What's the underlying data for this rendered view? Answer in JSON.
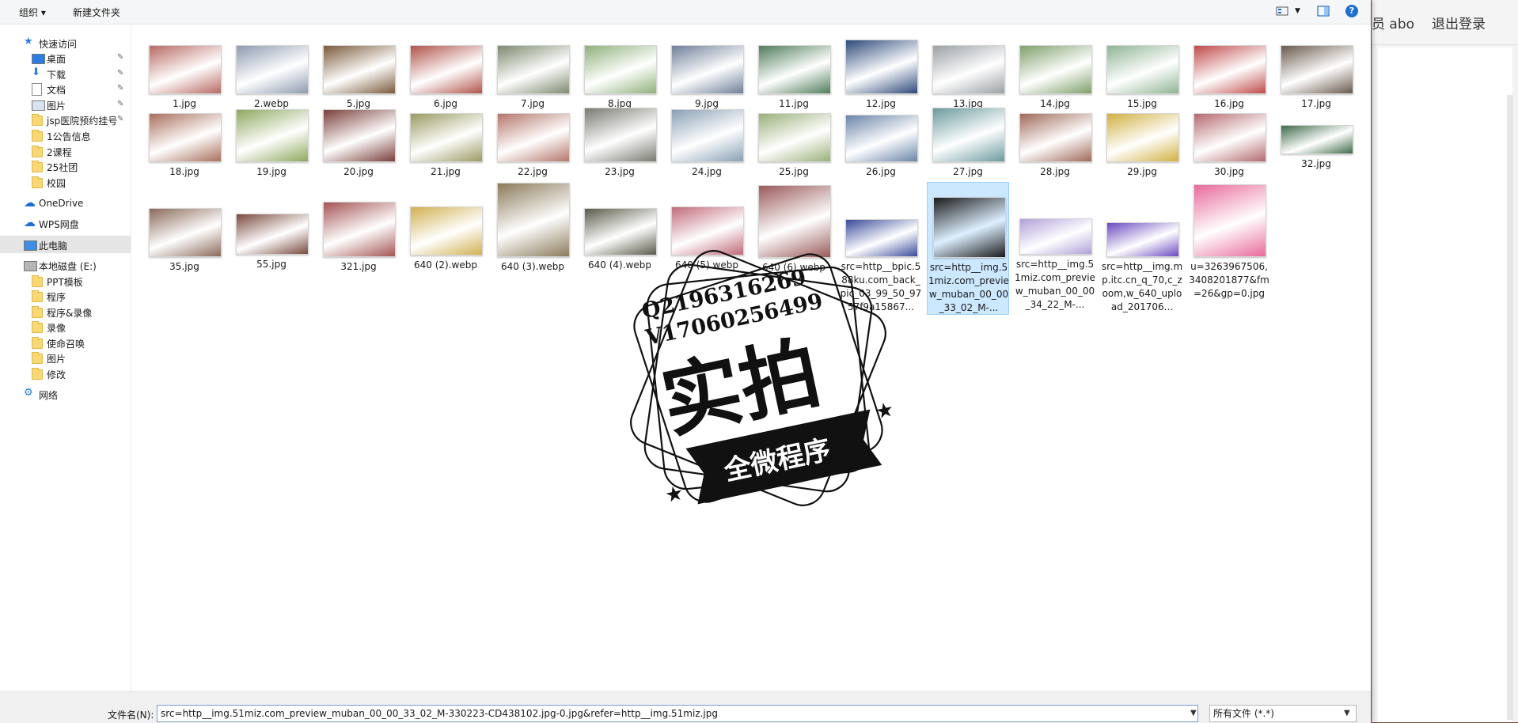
{
  "background_page": {
    "user_text": "员 abo",
    "logout_label": "退出登录"
  },
  "toolbar": {
    "organize_label": "组织 ▾",
    "new_folder_label": "新建文件夹",
    "help_label": "?"
  },
  "nav": {
    "items": [
      {
        "label": "快速访问",
        "icon": "star-icon"
      },
      {
        "label": "桌面",
        "icon": "desktop-icon",
        "pinned": true
      },
      {
        "label": "下载",
        "icon": "download-icon",
        "pinned": true
      },
      {
        "label": "文档",
        "icon": "document-icon",
        "pinned": true
      },
      {
        "label": "图片",
        "icon": "pictures-icon",
        "pinned": true
      },
      {
        "label": "jsp医院预约挂号",
        "icon": "folder-icon",
        "pinned": true
      },
      {
        "label": "1公告信息",
        "icon": "folder-icon"
      },
      {
        "label": "2课程",
        "icon": "folder-icon"
      },
      {
        "label": "25社团",
        "icon": "folder-icon"
      },
      {
        "label": "校园",
        "icon": "folder-icon"
      },
      {
        "label": "OneDrive",
        "icon": "cloud-icon"
      },
      {
        "label": "WPS网盘",
        "icon": "cloud-icon"
      },
      {
        "label": "此电脑",
        "icon": "computer-icon"
      },
      {
        "label": "本地磁盘 (E:)",
        "icon": "drive-icon"
      },
      {
        "label": "PPT模板",
        "icon": "folder-icon"
      },
      {
        "label": "程序",
        "icon": "folder-icon"
      },
      {
        "label": "程序&录像",
        "icon": "folder-icon"
      },
      {
        "label": "录像",
        "icon": "folder-icon"
      },
      {
        "label": "使命召唤",
        "icon": "folder-icon"
      },
      {
        "label": "图片",
        "icon": "folder-icon"
      },
      {
        "label": "修改",
        "icon": "folder-icon"
      },
      {
        "label": "网络",
        "icon": "network-icon"
      }
    ]
  },
  "files": [
    {
      "name": "1.jpg",
      "color": "#b86a63"
    },
    {
      "name": "2.webp",
      "color": "#8e9bb0"
    },
    {
      "name": "5.jpg",
      "color": "#7a5a3a"
    },
    {
      "name": "6.jpg",
      "color": "#b0534a"
    },
    {
      "name": "7.jpg",
      "color": "#7d8a6e"
    },
    {
      "name": "8.jpg",
      "color": "#8fb07a"
    },
    {
      "name": "9.jpg",
      "color": "#6f8099"
    },
    {
      "name": "11.jpg",
      "color": "#4f7d5a"
    },
    {
      "name": "12.jpg",
      "color": "#2e4a7a"
    },
    {
      "name": "13.jpg",
      "color": "#9aa0a4"
    },
    {
      "name": "14.jpg",
      "color": "#7fa06a"
    },
    {
      "name": "15.jpg",
      "color": "#8fb494"
    },
    {
      "name": "16.jpg",
      "color": "#c04a4a"
    },
    {
      "name": "17.jpg",
      "color": "#6a5a4e"
    },
    {
      "name": "18.jpg",
      "color": "#a8705c"
    },
    {
      "name": "19.jpg",
      "color": "#8ea85e"
    },
    {
      "name": "20.jpg",
      "color": "#7a3e3a"
    },
    {
      "name": "21.jpg",
      "color": "#9a9a62"
    },
    {
      "name": "22.jpg",
      "color": "#b4766a"
    },
    {
      "name": "23.jpg",
      "color": "#7a7a72"
    },
    {
      "name": "24.jpg",
      "color": "#8aa0b4"
    },
    {
      "name": "25.jpg",
      "color": "#9ab07a"
    },
    {
      "name": "26.jpg",
      "color": "#6a84a8"
    },
    {
      "name": "27.jpg",
      "color": "#6a9a9e"
    },
    {
      "name": "28.jpg",
      "color": "#a06a5a"
    },
    {
      "name": "29.jpg",
      "color": "#d0b040"
    },
    {
      "name": "30.jpg",
      "color": "#b46a6e"
    },
    {
      "name": "32.jpg",
      "color": "#3e6a4a"
    },
    {
      "name": "35.jpg",
      "color": "#8a6a5a"
    },
    {
      "name": "55.jpg",
      "color": "#7a4a3e"
    },
    {
      "name": "321.jpg",
      "color": "#a45454"
    },
    {
      "name": "640 (2).webp",
      "color": "#d0b050"
    },
    {
      "name": "640 (3).webp",
      "color": "#8a7a5a"
    },
    {
      "name": "640 (4).webp",
      "color": "#5a5a4a"
    },
    {
      "name": "640 (5).webp",
      "color": "#c06a7a"
    },
    {
      "name": "640 (6).webp",
      "color": "#9a5a5a"
    },
    {
      "name": "src=http__bpic.588ku.com_back_pic_03_99_50_9757f9a15867...",
      "color": "#3a4a9a"
    },
    {
      "name": "src=http__img.51miz.com_preview_muban_00_00_33_02_M-...",
      "color": "#1a1a1a",
      "selected": true
    },
    {
      "name": "src=http__img.51miz.com_preview_muban_00_00_34_22_M-...",
      "color": "#b0a0d8"
    },
    {
      "name": "src=http__img.mp.itc.cn_q_70,c_zoom,w_640_upload_201706...",
      "color": "#6a4ac0"
    },
    {
      "name": "u=3263967506,3408201877&fm=26&gp=0.jpg",
      "color": "#e86a9a"
    }
  ],
  "bottom": {
    "filename_label": "文件名(N):",
    "filename_value": "src=http__img.51miz.com_preview_muban_00_00_33_02_M-330223-CD438102.jpg-0.jpg&refer=http__img.51miz.jpg",
    "filetype_value": "所有文件 (*.*)"
  },
  "watermark": {
    "line1": "Q2196316269",
    "line2": "V17060256499",
    "big": "实拍",
    "banner": "全微程序"
  }
}
